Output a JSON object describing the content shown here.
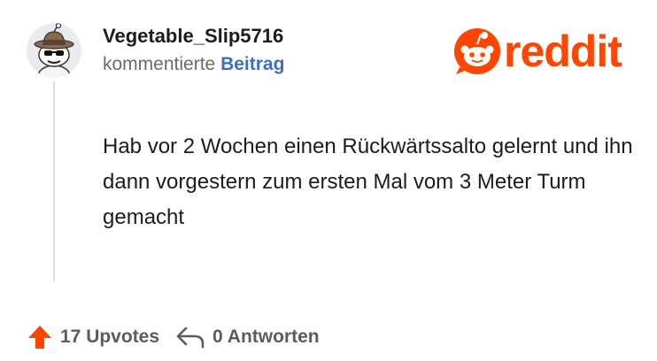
{
  "comment": {
    "author": "Vegetable_Slip5716",
    "meta_prefix": "kommentierte",
    "meta_link": "Beitrag",
    "body": "Hab vor 2 Wochen einen Rückwärtssalto gelernt und ihn dann vorgestern zum ersten Mal vom 3 Meter Turm gemacht"
  },
  "brand": {
    "wordmark": "reddit",
    "color": "#ff4500"
  },
  "actions": {
    "upvotes_label": "17 Upvotes",
    "replies_label": "0 Antworten",
    "upvote_icon": "arrow-up-icon",
    "reply_icon": "reply-arrow-icon"
  },
  "colors": {
    "meta_link": "#3b6fc4",
    "upvote_arrow": "#ff4500",
    "muted_text": "#6a6a6a"
  }
}
